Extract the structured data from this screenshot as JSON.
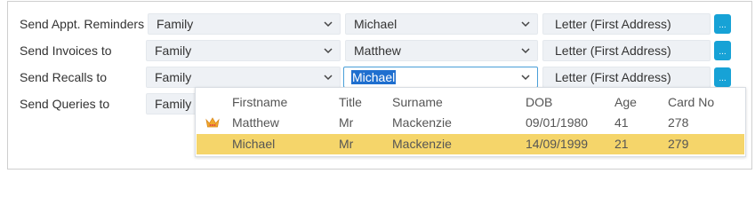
{
  "rows": [
    {
      "label": "Send Appt. Reminders",
      "type": "Family",
      "person": "Michael",
      "method": "Letter (First Address)"
    },
    {
      "label": "Send Invoices to",
      "type": "Family",
      "person": "Matthew",
      "method": "Letter (First Address)"
    },
    {
      "label": "Send Recalls to",
      "type": "Family",
      "person": "Michael",
      "method": "Letter (First Address)"
    },
    {
      "label": "Send Queries to",
      "type": "Family"
    }
  ],
  "more_button_label": "...",
  "dropdown": {
    "columns": [
      "Firstname",
      "Title",
      "Surname",
      "DOB",
      "Age",
      "Card No"
    ],
    "rows": [
      {
        "firstname": "Matthew",
        "title": "Mr",
        "surname": "Mackenzie",
        "dob": "09/01/1980",
        "age": "41",
        "card_no": "278",
        "icon": "crown-icon"
      },
      {
        "firstname": "Michael",
        "title": "Mr",
        "surname": "Mackenzie",
        "dob": "14/09/1999",
        "age": "21",
        "card_no": "279",
        "selected": true
      }
    ]
  },
  "colors": {
    "accent": "#17a2d6",
    "selection_highlight": "#f5d56a",
    "text_selection": "#1f6fcf",
    "field_bg": "#eef1f5"
  }
}
